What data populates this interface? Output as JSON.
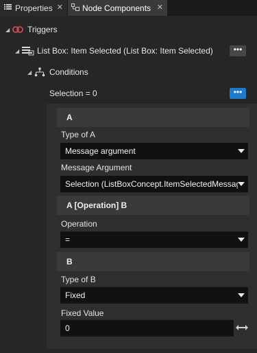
{
  "tabs": [
    {
      "label": "Properties",
      "icon": "list-icon"
    },
    {
      "label": "Node Components",
      "icon": "node-components-icon"
    }
  ],
  "tree": {
    "triggers_label": "Triggers",
    "trigger_item_label": "List Box: Item Selected (List Box: Item Selected)",
    "conditions_label": "Conditions",
    "condition_label": "Selection = 0",
    "menu_glyph": "•••"
  },
  "condition_editor": {
    "section_a": {
      "title": "A",
      "type_label": "Type of A",
      "type_value": "Message argument",
      "argument_label": "Message Argument",
      "argument_value": "Selection (ListBoxConcept.ItemSelectedMessage)"
    },
    "section_op": {
      "title": "A [Operation] B",
      "operation_label": "Operation",
      "operation_value": "="
    },
    "section_b": {
      "title": "B",
      "type_label": "Type of B",
      "type_value": "Fixed",
      "fixed_label": "Fixed Value",
      "fixed_value": "0"
    }
  },
  "colors": {
    "accent": "#1f7acd",
    "trigger_icon": "#e0505a"
  }
}
